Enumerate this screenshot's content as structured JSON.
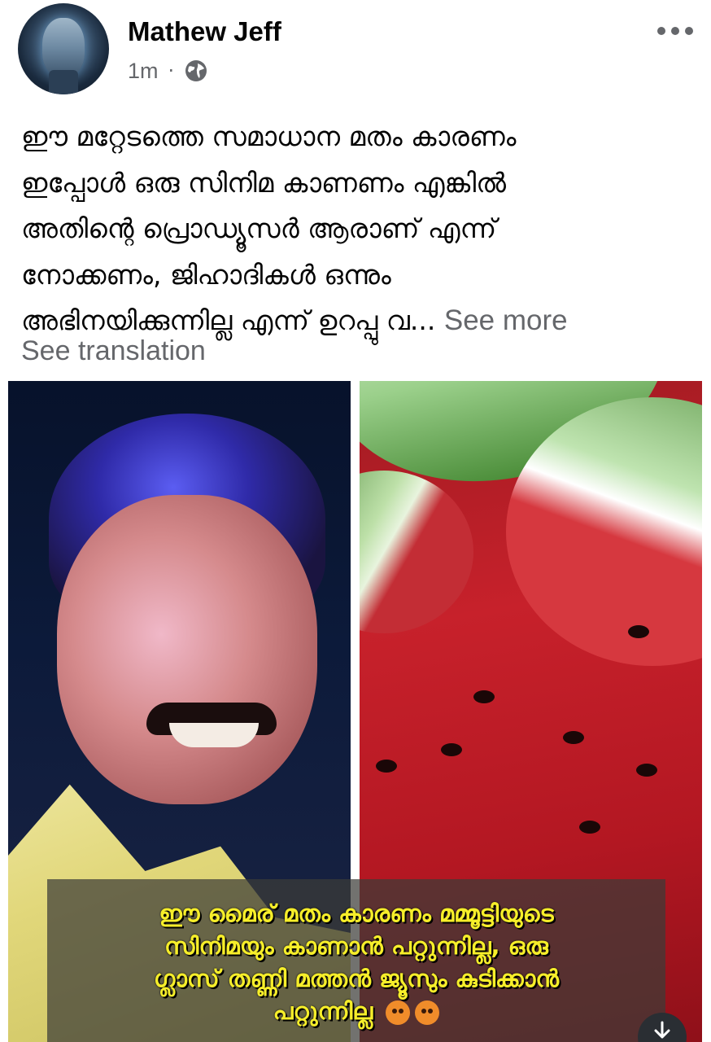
{
  "post": {
    "author": "Mathew Jeff",
    "time": "1m",
    "separator": "·",
    "privacy_icon": "globe-icon",
    "menu_icon": "more-horizontal-icon",
    "text_lines": [
      "ഈ മറ്റേടത്തെ സമാധാന മതം കാരണം",
      "ഇപ്പോൾ ഒരു സിനിമ കാണണം എങ്കിൽ",
      "അതിന്റെ പ്രൊഡ്യൂസർ ആരാണ് എന്ന്",
      "നോക്കണം, ജിഹാദികൾ ഒന്നും",
      "അഭിനയിക്കുന്നില്ല എന്ന് ഉറപ്പു വ..."
    ],
    "see_more": "See more",
    "see_translation": "See translation"
  },
  "image": {
    "caption_lines": [
      "ഈ മൈര് മതം കാരണം മമ്മൂട്ടിയുടെ",
      "സിനിമയും കാണാൻ പറ്റുന്നില്ല, ഒരു",
      "ഗ്ലാസ് തണ്ണി മത്തൻ ജ്യൂസും കുടിക്കാൻ",
      "പറ്റുന്നില്ല"
    ],
    "caption_emoji": "angry-face-icon"
  },
  "colors": {
    "text_primary": "#050505",
    "text_secondary": "#65676b",
    "caption_text": "#f6ee2a"
  }
}
